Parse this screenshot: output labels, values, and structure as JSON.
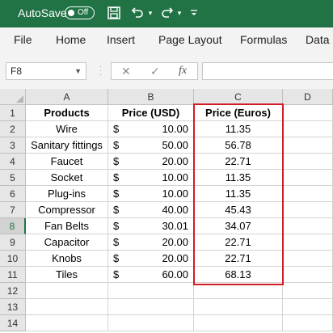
{
  "titlebar": {
    "autosave_label": "AutoSave",
    "toggle_state": "Off",
    "icons": [
      "save-icon",
      "undo-icon",
      "redo-icon",
      "customize-quick-access-icon"
    ],
    "color": "#217346"
  },
  "ribbon": {
    "tabs": [
      "File",
      "Home",
      "Insert",
      "Page Layout",
      "Formulas",
      "Data"
    ]
  },
  "formula_bar": {
    "name_box": "F8",
    "cancel_symbol": "✕",
    "enter_symbol": "✓",
    "function_symbol": "fx",
    "formula": ""
  },
  "sheet": {
    "columns": [
      "A",
      "B",
      "C",
      "D"
    ],
    "rows": [
      "1",
      "2",
      "3",
      "4",
      "5",
      "6",
      "7",
      "8",
      "9",
      "10",
      "11",
      "12",
      "13",
      "14"
    ],
    "active_row": "8",
    "headers": {
      "products": "Products",
      "price_usd": "Price (USD)",
      "price_euros": "Price (Euros)"
    },
    "data": [
      {
        "product": "Wire",
        "currency": "$",
        "usd": "10.00",
        "euros": "11.35"
      },
      {
        "product": "Sanitary fittings",
        "currency": "$",
        "usd": "50.00",
        "euros": "56.78"
      },
      {
        "product": "Faucet",
        "currency": "$",
        "usd": "20.00",
        "euros": "22.71"
      },
      {
        "product": "Socket",
        "currency": "$",
        "usd": "10.00",
        "euros": "11.35"
      },
      {
        "product": "Plug-ins",
        "currency": "$",
        "usd": "10.00",
        "euros": "11.35"
      },
      {
        "product": "Compressor",
        "currency": "$",
        "usd": "40.00",
        "euros": "45.43"
      },
      {
        "product": "Fan Belts",
        "currency": "$",
        "usd": "30.01",
        "euros": "34.07"
      },
      {
        "product": "Capacitor",
        "currency": "$",
        "usd": "20.00",
        "euros": "22.71"
      },
      {
        "product": "Knobs",
        "currency": "$",
        "usd": "20.00",
        "euros": "22.71"
      },
      {
        "product": "Tiles",
        "currency": "$",
        "usd": "60.00",
        "euros": "68.13"
      }
    ],
    "highlight_color": "#d11c24"
  }
}
